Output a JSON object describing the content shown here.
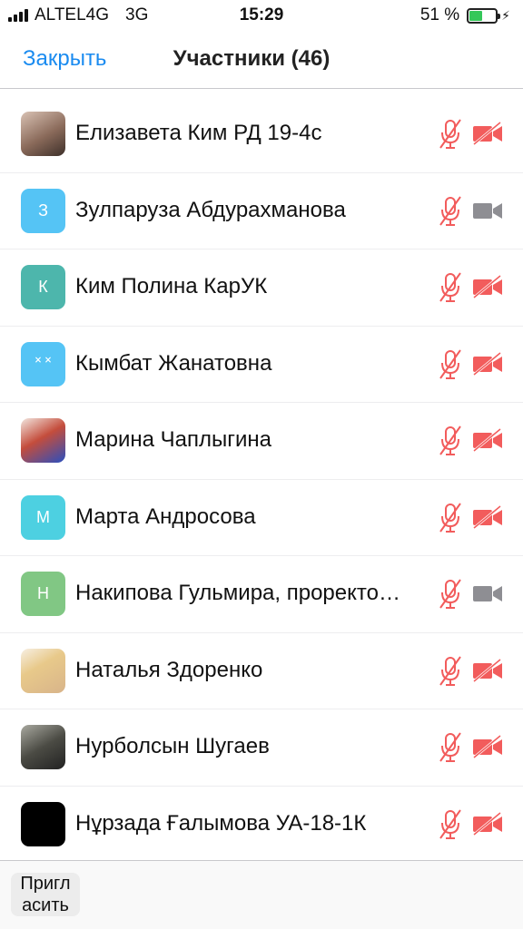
{
  "status_bar": {
    "carrier": "ALTEL4G",
    "network": "3G",
    "time": "15:29",
    "battery_percent": "51 %",
    "battery_level": 0.51,
    "battery_color": "#34c759"
  },
  "navbar": {
    "close_label": "Закрыть",
    "title": "Участники (46)"
  },
  "participants": [
    {
      "name": "Елизавета Ким РД 19-4с",
      "avatar_type": "photo",
      "avatar_letter": "",
      "mic_muted": true,
      "video_off": true
    },
    {
      "name": "Зулпаруза Абдурахманова",
      "avatar_type": "letter",
      "avatar_letter": "З",
      "avatar_color": "#55c4f5",
      "mic_muted": true,
      "video_off": false
    },
    {
      "name": "Ким Полина КарУК",
      "avatar_type": "letter",
      "avatar_letter": "К",
      "avatar_color": "#4db6ac",
      "mic_muted": true,
      "video_off": true
    },
    {
      "name": "Кымбат Жанатовна",
      "avatar_type": "letter",
      "avatar_letter": "˟ ˟",
      "avatar_color": "#55c4f5",
      "mic_muted": true,
      "video_off": true
    },
    {
      "name": "Марина Чаплыгина",
      "avatar_type": "photo",
      "avatar_letter": "",
      "mic_muted": true,
      "video_off": true
    },
    {
      "name": "Марта Андросова",
      "avatar_type": "letter",
      "avatar_letter": "М",
      "avatar_color": "#4dd0e1",
      "mic_muted": true,
      "video_off": true
    },
    {
      "name": "Накипова Гульмира, проректо…",
      "avatar_type": "letter",
      "avatar_letter": "Н",
      "avatar_color": "#81c784",
      "mic_muted": true,
      "video_off": false
    },
    {
      "name": "Наталья Здоренко",
      "avatar_type": "photo",
      "avatar_letter": "",
      "mic_muted": true,
      "video_off": true
    },
    {
      "name": "Нурболсын Шугаев",
      "avatar_type": "photo",
      "avatar_letter": "",
      "mic_muted": true,
      "video_off": true
    },
    {
      "name": "Нұрзада Ғалымова УА-18-1К",
      "avatar_type": "black",
      "avatar_letter": "",
      "mic_muted": true,
      "video_off": true
    }
  ],
  "bottom_bar": {
    "invite_label_line1": "Пригл",
    "invite_label_line2": "асить"
  },
  "colors": {
    "accent": "#1a8bf0",
    "muted_red": "#f25c5c",
    "video_gray": "#8e8e93"
  }
}
